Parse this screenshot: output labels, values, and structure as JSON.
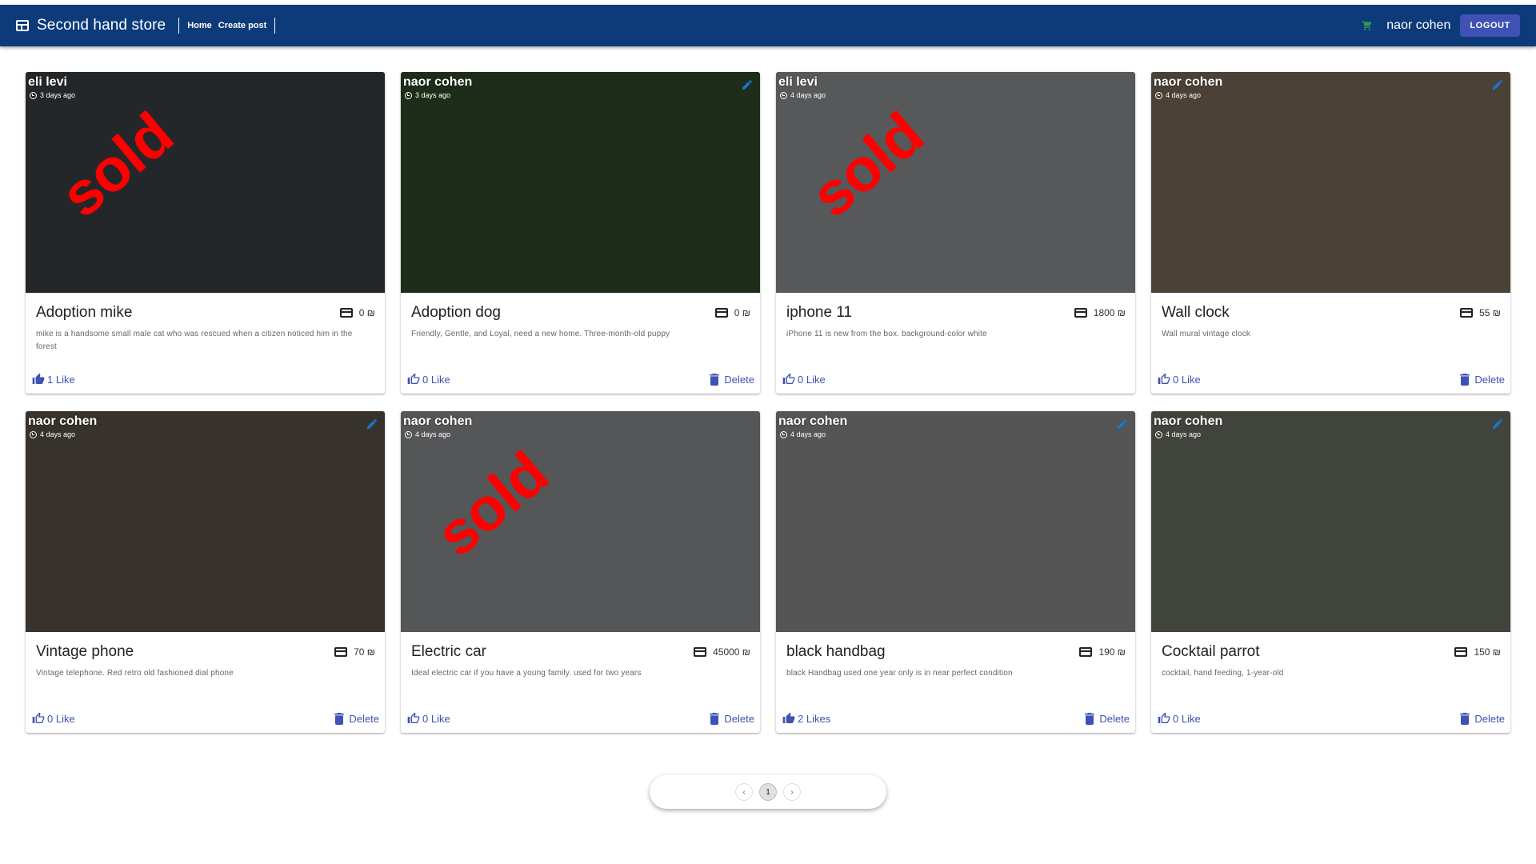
{
  "header": {
    "title": "Second hand store",
    "nav": [
      "Home",
      "Create post"
    ],
    "user": "naor cohen",
    "logout_label": "LOGOUT"
  },
  "posts": [
    {
      "owner": "eli levi",
      "time": "3 days ago",
      "title": "Adoption mike",
      "price": "0 ₪",
      "description": "mike is a handsome small male cat who was rescued when a citizen noticed him in the forest",
      "likes": "1 Like",
      "liked": true,
      "sold": true,
      "editable": false,
      "deletable": false,
      "bg": "#3a3f45"
    },
    {
      "owner": "naor cohen",
      "time": "3 days ago",
      "title": "Adoption dog",
      "price": "0 ₪",
      "description": "Friendly, Gentle, and Loyal, need a new home. Three-month-old puppy",
      "likes": "0 Like",
      "liked": false,
      "sold": false,
      "editable": true,
      "deletable": true,
      "bg": "#2f4a2a"
    },
    {
      "owner": "eli levi",
      "time": "4 days ago",
      "title": "iphone 11",
      "price": "1800 ₪",
      "description": "iPhone 11 is new from the box. background-color white",
      "likes": "0 Like",
      "liked": false,
      "sold": true,
      "editable": false,
      "deletable": false,
      "bg": "#8c8f92"
    },
    {
      "owner": "naor cohen",
      "time": "4 days ago",
      "title": "Wall clock",
      "price": "55 ₪",
      "description": "Wall mural vintage clock",
      "likes": "0 Like",
      "liked": false,
      "sold": false,
      "editable": true,
      "deletable": true,
      "bg": "#7a6a58"
    },
    {
      "owner": "naor cohen",
      "time": "4 days ago",
      "title": "Vintage phone",
      "price": "70 ₪",
      "description": "Vintage telephone. Red retro old fashioned dial phone",
      "likes": "0 Like",
      "liked": false,
      "sold": false,
      "editable": true,
      "deletable": true,
      "bg": "#5a5148"
    },
    {
      "owner": "naor cohen",
      "time": "4 days ago",
      "title": "Electric car",
      "price": "45000 ₪",
      "description": "Ideal electric car if you have a young family. used for two years",
      "likes": "0 Like",
      "liked": false,
      "sold": true,
      "editable": false,
      "deletable": true,
      "bg": "#8a8c8e"
    },
    {
      "owner": "naor cohen",
      "time": "4 days ago",
      "title": "black handbag",
      "price": "190 ₪",
      "description": "black Handbag used one year only is in near perfect condition",
      "likes": "2 Likes",
      "liked": true,
      "sold": false,
      "editable": true,
      "deletable": true,
      "bg": "#8a8a8a"
    },
    {
      "owner": "naor cohen",
      "time": "4 days ago",
      "title": "Cocktail parrot",
      "price": "150 ₪",
      "description": "cocktail, hand feeding, 1-year-old",
      "likes": "0 Like",
      "liked": false,
      "sold": false,
      "editable": true,
      "deletable": true,
      "bg": "#6a6e62"
    }
  ],
  "sold_label": "sold",
  "pagination": {
    "current": "1",
    "prev": "‹",
    "next": "›"
  }
}
